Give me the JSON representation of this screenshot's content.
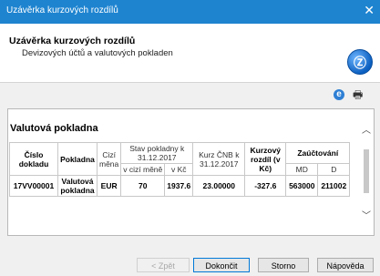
{
  "window": {
    "title": "Uzávěrka kurzových rozdílů",
    "close_glyph": "✕"
  },
  "header": {
    "title": "Uzávěrka kurzových rozdílů",
    "subtitle": "Devizových účtů a valutových pokladen",
    "logo_icon": "wizard-logo",
    "logo_glyph": "Ⓩ"
  },
  "toolbar": {
    "icons": [
      "ie-icon",
      "print-icon"
    ]
  },
  "section": {
    "title": "Valutová pokladna"
  },
  "table": {
    "headers": {
      "doc_no": "Číslo dokladu",
      "register": "Pokladna",
      "currency": "Cizí měna",
      "balance": "Stav pokladny k 31.12.2017",
      "balance_foreign": "v cizí měně",
      "balance_czk": "v Kč",
      "rate": "Kurz ČNB k 31.12.2017",
      "diff": "Kurzový rozdíl (v Kč)",
      "posting": "Zaúčtování",
      "md": "MD",
      "d": "D"
    },
    "rows": [
      {
        "doc_no": "17VV00001",
        "register": "Valutová pokladna",
        "currency": "EUR",
        "balance_foreign": "70",
        "balance_czk": "1937.6",
        "rate": "23.00000",
        "diff": "-327.6",
        "md": "563000",
        "d": "211002"
      }
    ]
  },
  "buttons": {
    "back": "< Zpět",
    "finish": "Dokončit",
    "cancel": "Storno",
    "help": "Nápověda"
  }
}
